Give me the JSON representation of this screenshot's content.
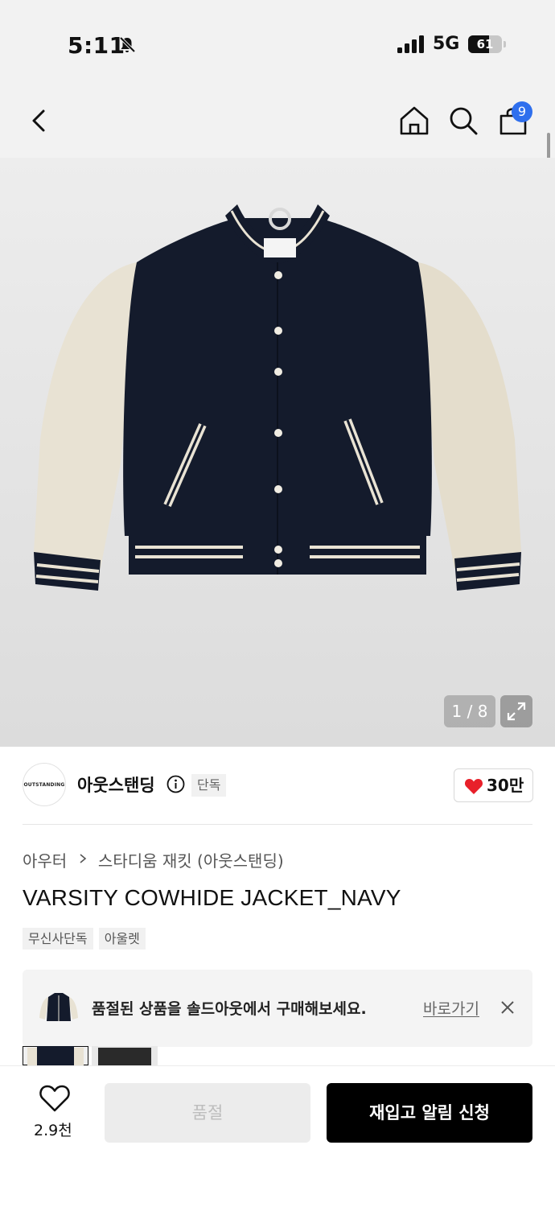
{
  "status_bar": {
    "time": "5:11",
    "network": "5G",
    "battery": "61",
    "battery_level": 0.61
  },
  "nav": {
    "icons": [
      "back-icon",
      "home-icon",
      "search-icon",
      "cart-icon"
    ],
    "cart_badge": "9"
  },
  "gallery": {
    "counter": "1 / 8"
  },
  "brand": {
    "logo_text": "OUTSTANDING",
    "name": "아웃스탠딩",
    "exclusive_tag": "단독",
    "like_count": "30만"
  },
  "product": {
    "breadcrumb": [
      "아우터",
      "스타디움 재킷 (아웃스탠딩)"
    ],
    "title": "VARSITY COWHIDE JACKET_NAVY",
    "tags": [
      "무신사단독",
      "아울렛"
    ]
  },
  "banner": {
    "text": "품절된 상품을 솔드아웃에서 구매해보세요.",
    "link": "바로가기"
  },
  "bottom": {
    "wish_count": "2.9천",
    "soldout_label": "품절",
    "restock_label": "재입고 알림 신청"
  },
  "colors": {
    "accent_blue": "#2f6fed",
    "heart_red": "#e8202a",
    "jacket_navy": "#141b2c",
    "sleeve_cream": "#e9e3d4"
  }
}
